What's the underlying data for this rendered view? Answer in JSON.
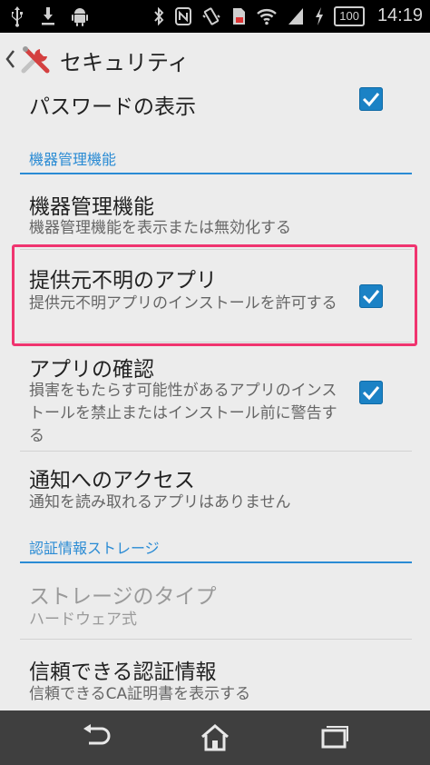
{
  "status_bar": {
    "battery": "100",
    "time": "14:19",
    "icons_left": [
      "usb-icon",
      "download-icon",
      "android-icon"
    ],
    "icons_right": [
      "bluetooth-icon",
      "nfc-icon",
      "vibrate-icon",
      "sim-icon",
      "wifi-icon",
      "signal-icon",
      "charging-icon"
    ]
  },
  "action_bar": {
    "title": "セキュリティ",
    "icon": "tools-icon"
  },
  "settings": {
    "show_password": {
      "title": "パスワードの表示",
      "checked": true
    },
    "header_device_admin": "機器管理機能",
    "device_admin": {
      "title": "機器管理機能",
      "summary": "機器管理機能を表示または無効化する"
    },
    "unknown_sources": {
      "title": "提供元不明のアプリ",
      "summary": "提供元不明アプリのインストールを許可する",
      "checked": true
    },
    "verify_apps": {
      "title": "アプリの確認",
      "summary": "損害をもたらす可能性があるアプリのインストールを禁止またはインストール前に警告する",
      "checked": true
    },
    "notification_access": {
      "title": "通知へのアクセス",
      "summary": "通知を読み取れるアプリはありません"
    },
    "header_credentials": "認証情報ストレージ",
    "storage_type": {
      "title": "ストレージのタイプ",
      "summary": "ハードウェア式"
    },
    "trusted_credentials": {
      "title": "信頼できる認証情報",
      "summary": "信頼できるCA証明書を表示する"
    }
  },
  "colors": {
    "accent": "#2a8bd4",
    "checkbox": "#1b82c5",
    "highlight": "#f0346f"
  },
  "nav_bar": {
    "icons": [
      "back-icon",
      "home-icon",
      "recent-apps-icon"
    ]
  }
}
